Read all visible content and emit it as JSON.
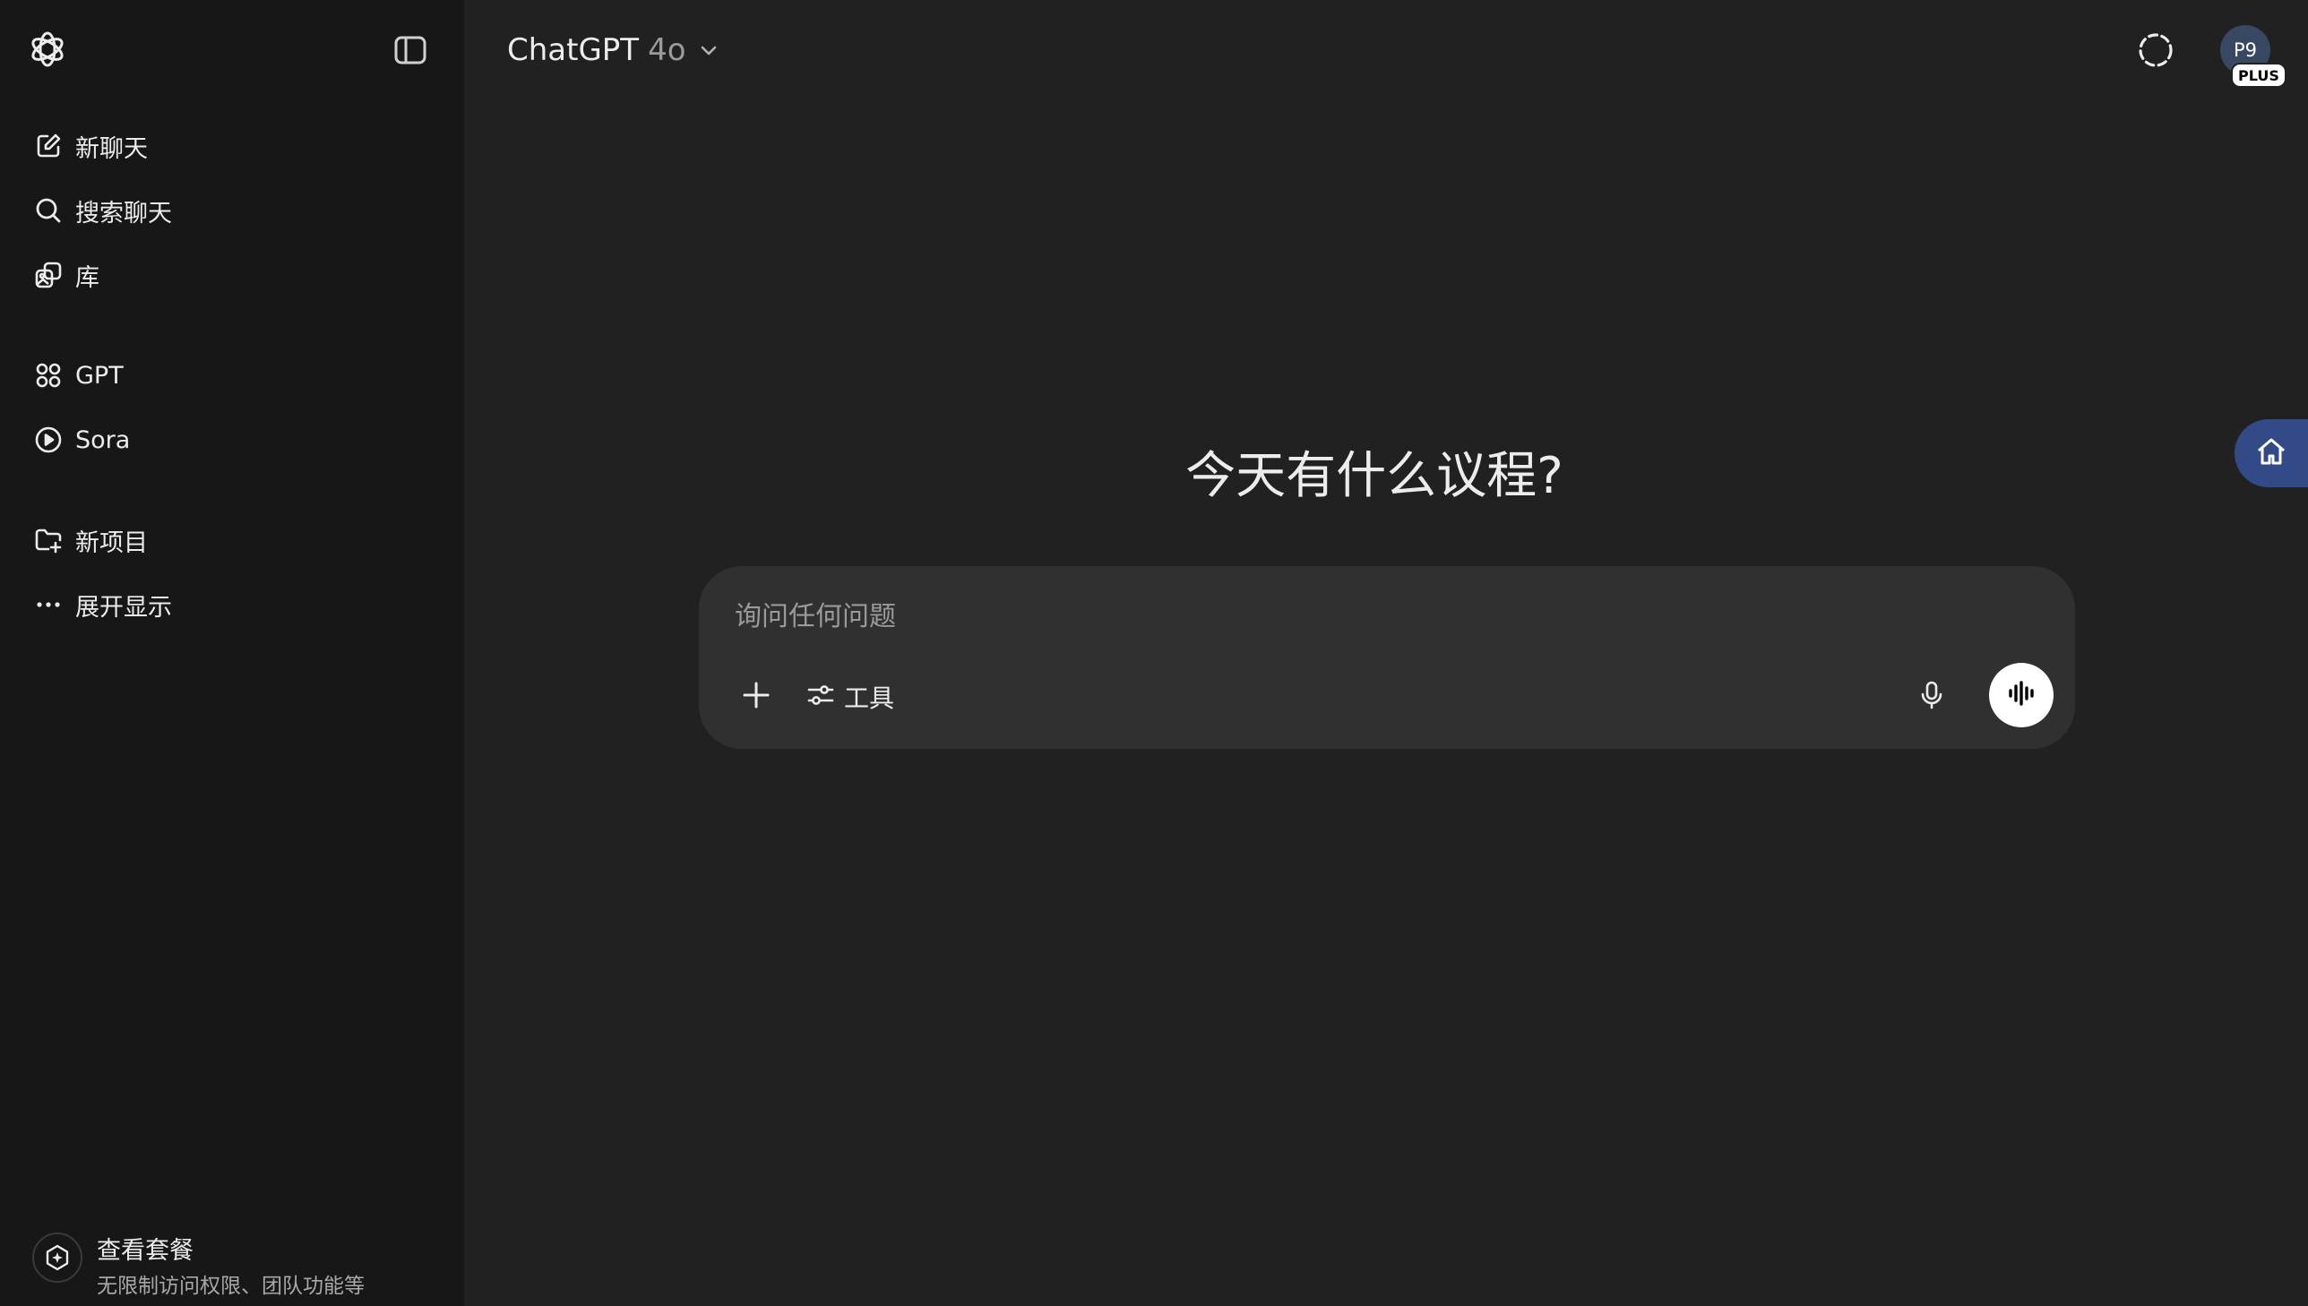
{
  "sidebar": {
    "items": [
      {
        "label": "新聊天",
        "icon": "edit-icon"
      },
      {
        "label": "搜索聊天",
        "icon": "search-icon"
      },
      {
        "label": "库",
        "icon": "library-icon"
      },
      {
        "label": "GPT",
        "icon": "grid-icon"
      },
      {
        "label": "Sora",
        "icon": "play-circle-icon"
      },
      {
        "label": "新项目",
        "icon": "folder-plus-icon"
      },
      {
        "label": "展开显示",
        "icon": "more-horizontal-icon"
      }
    ],
    "upgrade": {
      "title": "查看套餐",
      "subtitle": "无限制访问权限、团队功能等"
    }
  },
  "header": {
    "model_name": "ChatGPT",
    "model_version": "4o",
    "avatar_initials": "P9",
    "plan_badge": "PLUS"
  },
  "main": {
    "headline": "今天有什么议程?",
    "composer": {
      "placeholder": "询问任何问题",
      "value": "",
      "tools_label": "工具"
    }
  },
  "colors": {
    "background": "#212121",
    "sidebar": "#171717",
    "composer": "#303030",
    "avatar": "#384863",
    "float_button": "#324a88"
  }
}
